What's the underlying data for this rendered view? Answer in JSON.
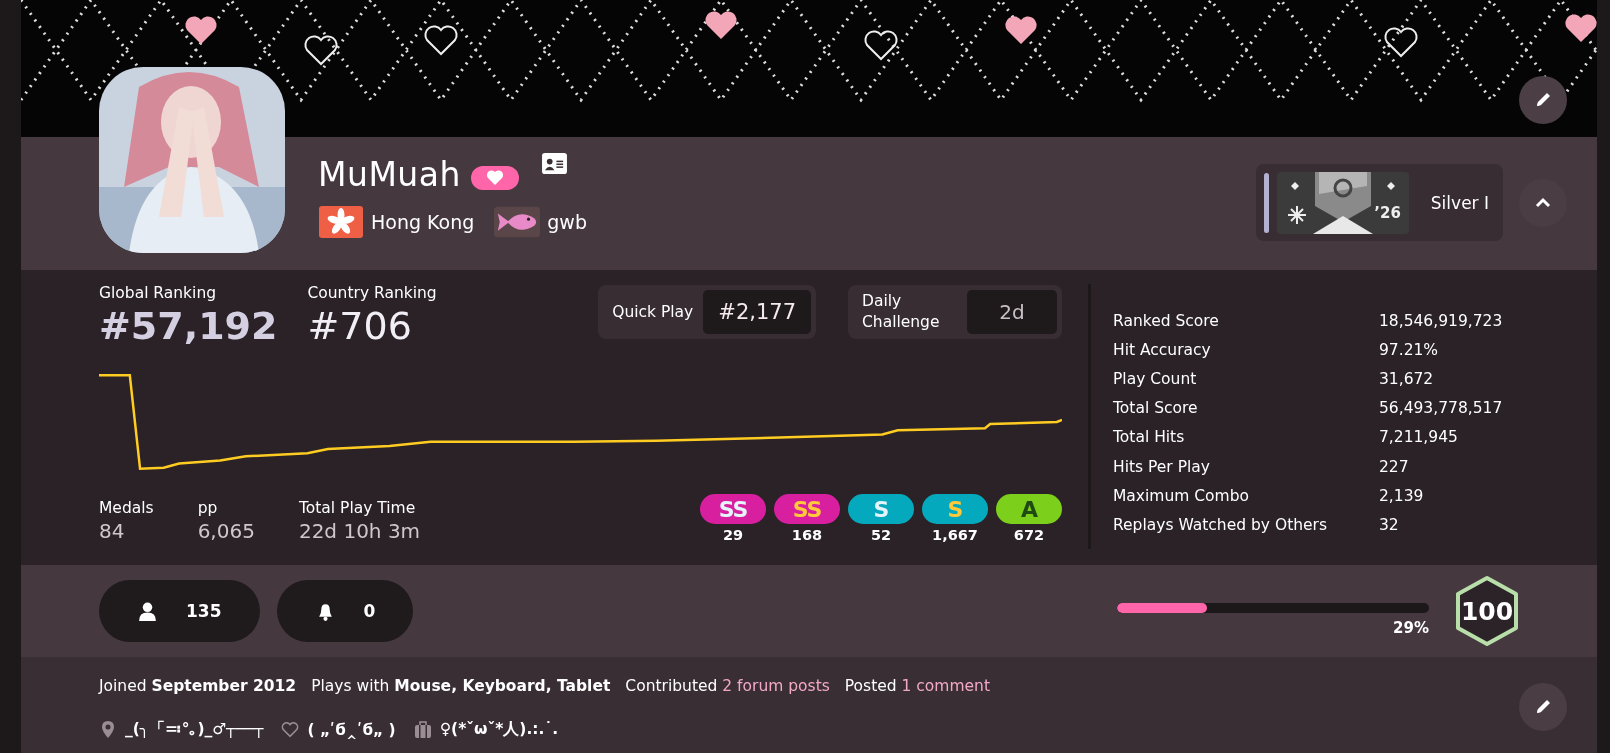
{
  "user": {
    "name": "MuMuah",
    "supporter": true,
    "country": "Hong Kong",
    "team": "gwb"
  },
  "season_badge": {
    "season_label": "’26",
    "rank": "Silver I"
  },
  "ranks": [
    {
      "label": "Global Ranking",
      "value": "#57,192"
    },
    {
      "label": "Country Ranking",
      "value": "#706"
    }
  ],
  "modes": [
    {
      "label": "Quick Play",
      "value": "#2,177",
      "active": true
    },
    {
      "label": "Daily Challenge",
      "value": "2d",
      "active": false
    }
  ],
  "summary": [
    {
      "label": "Medals",
      "value": "84"
    },
    {
      "label": "pp",
      "value": "6,065"
    },
    {
      "label": "Total Play Time",
      "value": "22d 10h 3m"
    }
  ],
  "grades": [
    {
      "label": "SS",
      "count": "29",
      "kind": "silver",
      "color": "#d81fa0"
    },
    {
      "label": "SS",
      "count": "168",
      "kind": "gold",
      "color": "#d81fa0"
    },
    {
      "label": "S",
      "count": "52",
      "kind": "silver",
      "color": "#05a9be"
    },
    {
      "label": "S",
      "count": "1,667",
      "kind": "gold",
      "color": "#05a9be"
    },
    {
      "label": "A",
      "count": "672",
      "kind": "plain",
      "color": "#7ccf1a"
    }
  ],
  "stats": [
    {
      "label": "Ranked Score",
      "value": "18,546,919,723"
    },
    {
      "label": "Hit Accuracy",
      "value": "97.21%"
    },
    {
      "label": "Play Count",
      "value": "31,672"
    },
    {
      "label": "Total Score",
      "value": "56,493,778,517"
    },
    {
      "label": "Total Hits",
      "value": "7,211,945"
    },
    {
      "label": "Hits Per Play",
      "value": "227"
    },
    {
      "label": "Maximum Combo",
      "value": "2,139"
    },
    {
      "label": "Replays Watched by Others",
      "value": "32"
    }
  ],
  "social": [
    {
      "kind": "followers",
      "count": "135"
    },
    {
      "kind": "notifications",
      "count": "0"
    }
  ],
  "level_progress": {
    "level": 0.29,
    "reading": "29%",
    "current_level": "100"
  },
  "info": [
    {
      "text": "Joined **September 2012**"
    },
    {
      "text": "Plays with **Mouse, Keyboard, Tablet**"
    },
    {
      "text": "Contributed ",
      "link": "2 forum posts"
    },
    {
      "text": "Posted ",
      "link": "1 comment"
    }
  ],
  "extras": [
    {
      "kind": "location",
      "text": "_(╮「≕°｡)_♂┬──┬"
    },
    {
      "kind": "interests",
      "text": "( „ʹϭ‸ʹϭ„ )"
    },
    {
      "kind": "occupation",
      "text": "♀(*ˇωˇ*人).:.˙."
    }
  ]
}
